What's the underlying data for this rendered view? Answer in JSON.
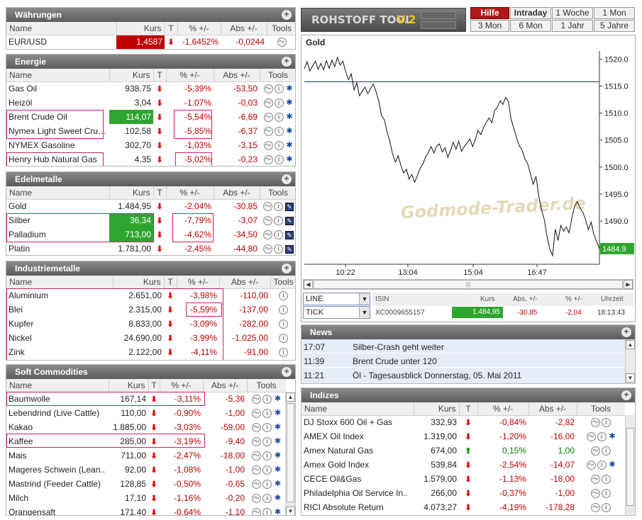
{
  "waehrungen": {
    "title": "Währungen",
    "headers": [
      "Name",
      "Kurs",
      "T",
      "% +/-",
      "Abs +/-",
      "Tools"
    ],
    "rows": [
      {
        "name": "EUR/USD",
        "kurs": "1,4587",
        "pct": "-1,6452%",
        "abs": "-0,0244"
      }
    ]
  },
  "energie": {
    "title": "Energie",
    "headers": [
      "Name",
      "Kurs",
      "T",
      "% +/-",
      "Abs +/-",
      "Tools"
    ],
    "rows": [
      {
        "name": "Gas Oil",
        "kurs": "938,75",
        "pct": "-5,39%",
        "abs": "-53,50"
      },
      {
        "name": "Heizöl",
        "kurs": "3,04",
        "pct": "-1,07%",
        "abs": "-0,03"
      },
      {
        "name": "Brent Crude Oil",
        "kurs": "114,07",
        "pct": "-5,54%",
        "abs": "-6,69"
      },
      {
        "name": "Nymex Light Sweet Crud..",
        "kurs": "102,58",
        "pct": "-5,85%",
        "abs": "-6,37"
      },
      {
        "name": "NYMEX Gasoline",
        "kurs": "302,70",
        "pct": "-1,03%",
        "abs": "-3,15"
      },
      {
        "name": "Henry Hub Natural Gas",
        "kurs": "4,35",
        "pct": "-5,02%",
        "abs": "-0,23"
      }
    ]
  },
  "edelmetalle": {
    "title": "Edelmetalle",
    "headers": [
      "Name",
      "Kurs",
      "T",
      "% +/-",
      "Abs +/-",
      "Tools"
    ],
    "rows": [
      {
        "name": "Gold",
        "kurs": "1.484,95",
        "pct": "-2,04%",
        "abs": "-30,85"
      },
      {
        "name": "Silber",
        "kurs": "36,34",
        "pct": "-7,79%",
        "abs": "-3,07"
      },
      {
        "name": "Palladium",
        "kurs": "713,00",
        "pct": "-4,62%",
        "abs": "-34,50"
      },
      {
        "name": "Platin",
        "kurs": "1.781,00",
        "pct": "-2,45%",
        "abs": "-44,80"
      }
    ]
  },
  "industriemetalle": {
    "title": "Industriemetalle",
    "headers": [
      "Name",
      "Kurs",
      "T",
      "% +/-",
      "Abs +/-",
      "Tools"
    ],
    "rows": [
      {
        "name": "Aluminium",
        "kurs": "2.651,00",
        "pct": "-3,98%",
        "abs": "-110,00"
      },
      {
        "name": "Blei",
        "kurs": "2.315,00",
        "pct": "-5,59%",
        "abs": "-137,00"
      },
      {
        "name": "Kupfer",
        "kurs": "8.833,00",
        "pct": "-3,09%",
        "abs": "-282,00"
      },
      {
        "name": "Nickel",
        "kurs": "24.690,00",
        "pct": "-3,99%",
        "abs": "-1.025,00"
      },
      {
        "name": "Zink",
        "kurs": "2.122,00",
        "pct": "-4,11%",
        "abs": "-91,00"
      }
    ]
  },
  "soft": {
    "title": "Soft Commodities",
    "headers": [
      "Name",
      "Kurs",
      "T",
      "% +/-",
      "Abs +/-",
      "Tools"
    ],
    "rows": [
      {
        "name": "Baumwolle",
        "kurs": "167,14",
        "pct": "-3,11%",
        "abs": "-5,36"
      },
      {
        "name": "Lebendrind (Live Cattle)",
        "kurs": "110,00",
        "pct": "-0,90%",
        "abs": "-1,00"
      },
      {
        "name": "Kakao",
        "kurs": "1.885,00",
        "pct": "-3,03%",
        "abs": "-59,00"
      },
      {
        "name": "Kaffee",
        "kurs": "285,00",
        "pct": "-3,19%",
        "abs": "-9,40"
      },
      {
        "name": "Mais",
        "kurs": "711,00",
        "pct": "-2,47%",
        "abs": "-18,00"
      },
      {
        "name": "Mageres Schwein (Lean..",
        "kurs": "92,00",
        "pct": "-1,08%",
        "abs": "-1,00"
      },
      {
        "name": "Mastrind (Feeder Cattle)",
        "kurs": "128,85",
        "pct": "-0,50%",
        "abs": "-0,65"
      },
      {
        "name": "Milch",
        "kurs": "17,10",
        "pct": "-1,16%",
        "abs": "-0,20"
      },
      {
        "name": "Orangensaft",
        "kurs": "171,40",
        "pct": "-0,64%",
        "abs": "-1,10"
      }
    ]
  },
  "tool": {
    "logo": "ROHSTOFF TOOL",
    "version": "V.2",
    "buttons": [
      "Hilfe",
      "Intraday",
      "1 Woche",
      "1 Mon",
      "3 Mon",
      "6 Mon",
      "1 Jahr",
      "5 Jahre"
    ],
    "chart_title": "Gold",
    "watermark": "Godmode-Trader.de"
  },
  "chart_data": {
    "type": "line",
    "title": "Gold",
    "x_ticks": [
      "10:22",
      "13:04",
      "15:04",
      "16:47"
    ],
    "y_ticks": [
      "1520.0",
      "1515.0",
      "1510.0",
      "1505.0",
      "1500.0",
      "1495.0",
      "1490.0",
      "1485.0"
    ],
    "ylim": [
      1482,
      1521.5
    ],
    "last_label": "1484.9",
    "reference_line": 1515.8,
    "values": [
      1518.2,
      1519.5,
      1517.8,
      1518.7,
      1519.6,
      1518.1,
      1519.2,
      1518.0,
      1519.7,
      1518.3,
      1519.8,
      1518.6,
      1520.3,
      1518.9,
      1519.6,
      1517.7,
      1516.2,
      1517.3,
      1514.3,
      1515.6,
      1513.2,
      1514.1,
      1514.8,
      1513.6,
      1514.5,
      1515.4,
      1514.0,
      1512.2,
      1509.5,
      1508.8,
      1506.5,
      1504.8,
      1502.4,
      1500.9,
      1502.1,
      1500.3,
      1498.9,
      1499.6,
      1497.8,
      1498.6,
      1497.2,
      1498.4,
      1499.8,
      1500.6,
      1501.9,
      1502.7,
      1503.8,
      1502.6,
      1503.9,
      1504.3,
      1502.8,
      1503.6,
      1501.8,
      1503.1,
      1504.6,
      1503.3,
      1504.8,
      1502.9,
      1503.8,
      1504.5,
      1505.2,
      1503.8,
      1505.1,
      1506.8,
      1506.0,
      1507.4,
      1508.3,
      1509.1,
      1508.2,
      1510.5,
      1511.1,
      1512.3,
      1511.6,
      1512.9,
      1512.1,
      1508.8,
      1507.1,
      1505.3,
      1503.9,
      1503.1,
      1501.5,
      1500.6,
      1498.7,
      1496.8,
      1498.3,
      1494.6,
      1492.1,
      1490.3,
      1487.2,
      1484.8,
      1483.6,
      1488.5,
      1486.4,
      1489.2,
      1488.1,
      1488.9,
      1487.8,
      1490.5,
      1492.8,
      1493.6,
      1492.4,
      1491.6,
      1490.2,
      1488.4,
      1489.8,
      1487.5,
      1486.2,
      1484.9
    ]
  },
  "instrument": {
    "select1": "LINE",
    "select2": "TICK",
    "headers": [
      "ISIN",
      "Kurs",
      "Abs. +/-",
      "% +/-",
      "Uhrzeit"
    ],
    "isin": "XC0009655157",
    "kurs": "1.484,95",
    "abs": "-30,85",
    "pct": "-2,04",
    "time": "18:13:43"
  },
  "news": {
    "title": "News",
    "items": [
      {
        "time": "17:07",
        "text": "Silber-Crash geht weiter"
      },
      {
        "time": "11:39",
        "text": "Brent Crude unter 120"
      },
      {
        "time": "11:21",
        "text": "Öl - Tagesausblick Donnerstag, 05. Mai 2011"
      }
    ]
  },
  "indizes": {
    "title": "Indizes",
    "headers": [
      "Name",
      "Kurs",
      "T",
      "% +/-",
      "Abs +/-",
      "Tools"
    ],
    "rows": [
      {
        "name": "DJ Stoxx 600 Oil + Gas",
        "kurs": "332,93",
        "pct": "-0,84%",
        "abs": "-2,82",
        "dir": "down"
      },
      {
        "name": "AMEX Oil Index",
        "kurs": "1.319,00",
        "pct": "-1,20%",
        "abs": "-16,00",
        "dir": "down"
      },
      {
        "name": "Amex Natural Gas",
        "kurs": "674,00",
        "pct": "0,15%",
        "abs": "1,00",
        "dir": "up"
      },
      {
        "name": "Amex Gold Index",
        "kurs": "539,84",
        "pct": "-2,54%",
        "abs": "-14,07",
        "dir": "down"
      },
      {
        "name": "CECE Oil&Gas",
        "kurs": "1.579,00",
        "pct": "-1,13%",
        "abs": "-18,00",
        "dir": "down"
      },
      {
        "name": "Philadelphia Oil Service In..",
        "kurs": "266,00",
        "pct": "-0,37%",
        "abs": "-1,00",
        "dir": "down"
      },
      {
        "name": "RICI Absolute Return",
        "kurs": "4.073,27",
        "pct": "-4,19%",
        "abs": "-178,28",
        "dir": "down"
      }
    ]
  }
}
